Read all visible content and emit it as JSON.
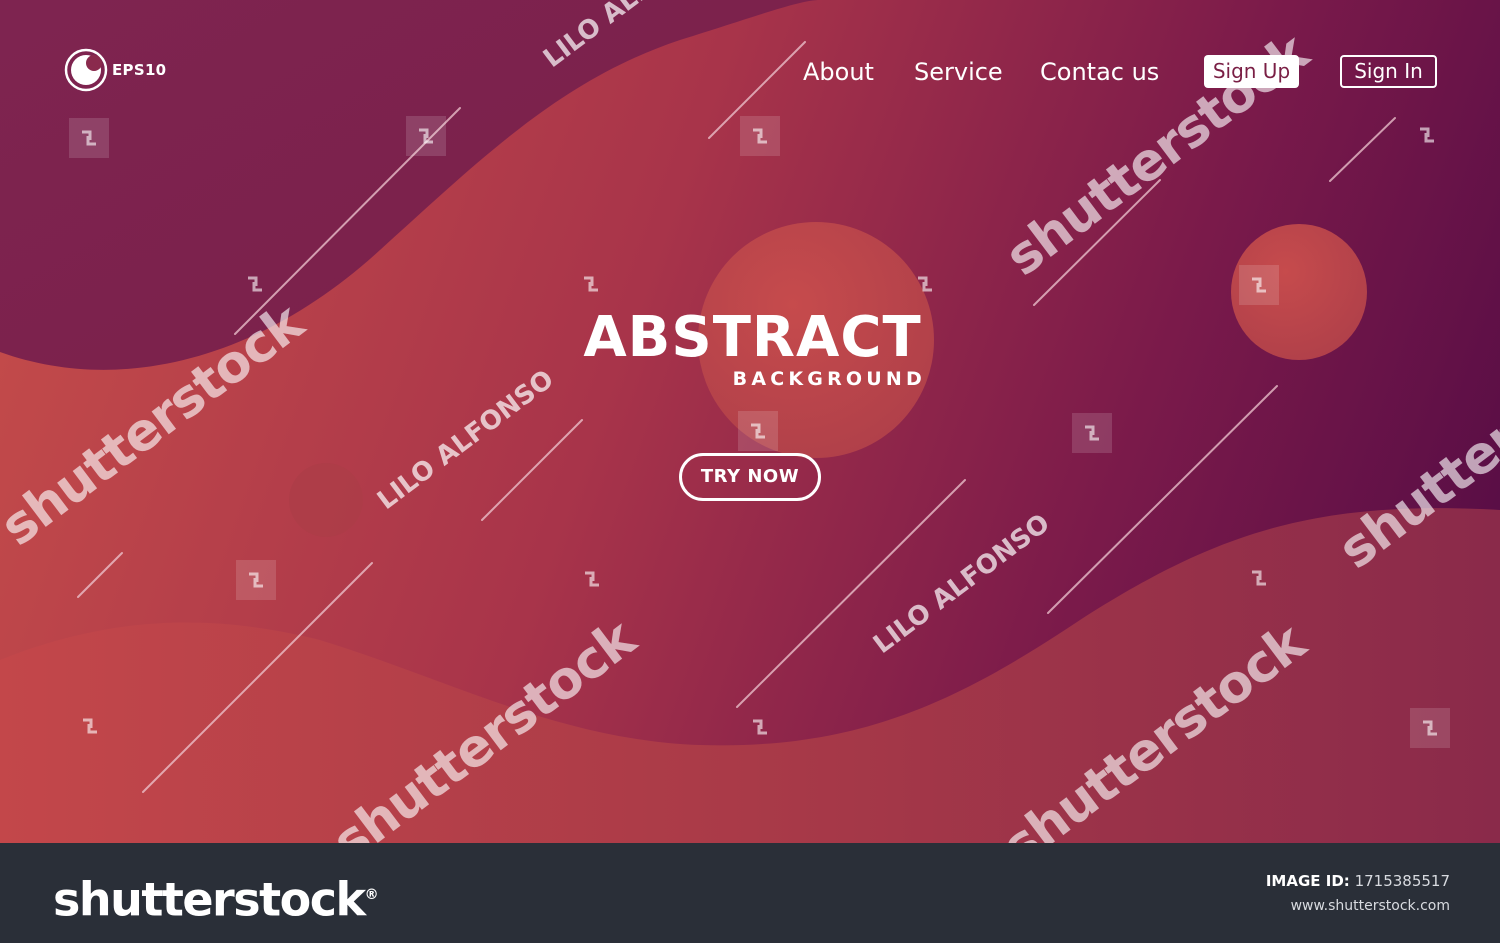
{
  "header": {
    "logo_text": "EPS10",
    "nav": [
      {
        "label": "About"
      },
      {
        "label": "Service"
      },
      {
        "label": "Contac us"
      }
    ],
    "sign_up_label": "Sign Up",
    "sign_in_label": "Sign In"
  },
  "hero": {
    "headline": "ABSTRACT",
    "subline": "BACKGROUND",
    "cta_label": "TRY NOW"
  },
  "watermarks": {
    "brand": "shutterstock",
    "author": "LILO ALFONSO"
  },
  "footer": {
    "logo_text": "shutterstock",
    "logo_mark": "®",
    "image_id_label": "IMAGE ID:",
    "image_id_value": "1715385517",
    "site_url": "www.shutterstock.com"
  },
  "colors": {
    "deep_purple": "#5c1248",
    "magenta": "#8a2147",
    "coral": "#c2474a",
    "footer_bg": "#2a2f38",
    "white": "#ffffff"
  },
  "icons": [
    "logo-badge-icon",
    "watermark-stamp-icon"
  ]
}
